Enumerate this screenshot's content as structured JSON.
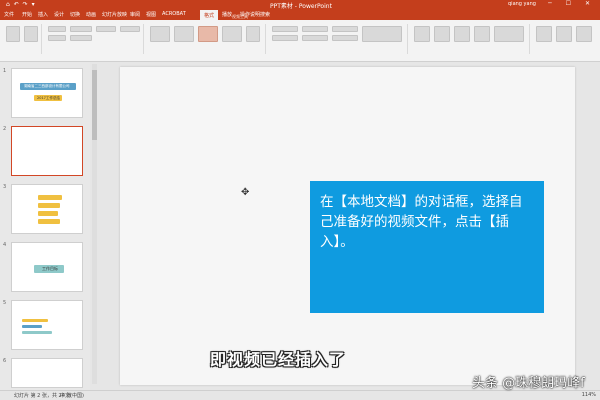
{
  "titlebar": {
    "quick_access": "⌂ ↶ ↷ ▾",
    "document_title": "PPT素材 - PowerPoint",
    "user": "qiang yang",
    "window_controls": "─ ☐ ✕"
  },
  "ribbon_tabs": {
    "context_label": "视频工具",
    "items": [
      "文件",
      "开始",
      "插入",
      "设计",
      "切换",
      "动画",
      "幻灯片放映",
      "审阅",
      "视图",
      "ACROBAT",
      "格式",
      "播放",
      "操作说明搜索"
    ],
    "active_index": 10
  },
  "slide": {
    "callout_text": "在【本地文档】的对话框，选择自己准备好的视频文件，点击【插入】。"
  },
  "caption": "即视频已经插入了",
  "watermark": "头条 @珠穆朗玛峰f",
  "statusbar": {
    "slide_info": "幻灯片 第 2 张，共 24 张",
    "language": "中文(中国)",
    "zoom": "114%"
  },
  "colors": {
    "accent": "#c43e1c",
    "callout_bg": "#0f9be0",
    "selected_thumb_border": "#d24726"
  },
  "thumbnails": {
    "numbers": [
      "1",
      "2",
      "3",
      "4",
      "5",
      "6"
    ],
    "thumb1_title": "湖南省二三西部设计有限公司",
    "thumb1_subtitle": "2017工作总结",
    "thumb4_title": "工作目标"
  }
}
